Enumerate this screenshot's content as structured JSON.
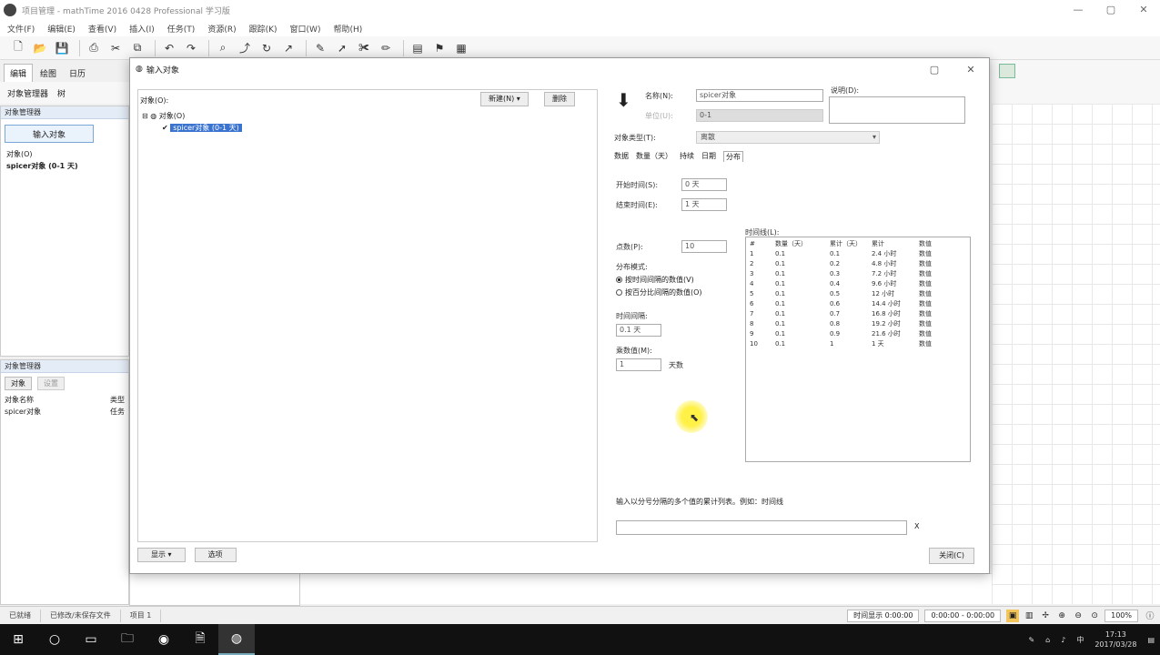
{
  "app": {
    "title": "项目管理 - mathTime 2016 0428 Professional 学习版",
    "window_controls": [
      "—",
      "▢",
      "✕"
    ]
  },
  "menu": [
    "文件(F)",
    "编辑(E)",
    "查看(V)",
    "插入(I)",
    "任务(T)",
    "资源(R)",
    "跟踪(K)",
    "窗口(W)",
    "帮助(H)"
  ],
  "main_tabs": [
    "编辑",
    "绘图",
    "日历"
  ],
  "sub_toolbar": [
    "对象管理器",
    "树"
  ],
  "left_panel": {
    "header": "对象管理器",
    "input_button": "输入对象",
    "tree": [
      "对象(O)",
      "spicer对象 (0-1 天)"
    ]
  },
  "lower_panel": {
    "header": "对象管理器",
    "toolbar": [
      "对象",
      "设置"
    ],
    "rows": [
      {
        "name": "对象名称",
        "value": "类型"
      },
      {
        "name": "spicer对象",
        "value": "任务"
      }
    ]
  },
  "statusbar": {
    "left": [
      "已就绪",
      "已修改/未保存文件",
      "项目 1"
    ],
    "right_fields": [
      "时间显示 0:00:00",
      "0:00:00 - 0:00:00"
    ],
    "zoom": "100%"
  },
  "taskbar": {
    "time": "17:13",
    "date": "2017/03/28"
  },
  "dialog": {
    "title": "输入对象",
    "left": {
      "label": "对象(O):",
      "btn_new": "新建(N) ▾",
      "btn_delete": "删除",
      "tree_root": "对象(O)",
      "tree_selected": "spicer对象 (0-1 天)"
    },
    "bottom_buttons": [
      "显示 ▾",
      "选项"
    ],
    "close_button": "关闭(C)",
    "right": {
      "name_label": "名称(N):",
      "name_value": "spicer对象",
      "unit_label": "单位(U):",
      "unit_value": "0-1",
      "notes_label": "说明(D):",
      "type_label": "对象类型(T):",
      "type_value": "离散",
      "subtabs": [
        "数据",
        "数量（天）",
        "持续",
        "日期",
        "分布"
      ],
      "start_label": "开始时间(S):",
      "start_value": "0 天",
      "end_label": "结束时间(E):",
      "end_value": "1 天",
      "count_label": "点数(P):",
      "count_value": "10",
      "timeline_label": "时间线(L):",
      "radio_title": "分布模式:",
      "radio_1": "按时间间隔的数值(V)",
      "radio_2": "按百分比间隔的数值(O)",
      "interval_label": "时间间隔:",
      "interval_value": "0.1 天",
      "multiplier_label": "乘数值(M):",
      "multiplier_value": "1",
      "multiplier_unit": "天数",
      "table_headers": [
        "#",
        "数量（天）",
        "累计（天）",
        "累计",
        "数值"
      ],
      "table_rows": [
        [
          "1",
          "0.1",
          "0.1",
          "2.4 小时",
          "数值"
        ],
        [
          "2",
          "0.1",
          "0.2",
          "4.8 小时",
          "数值"
        ],
        [
          "3",
          "0.1",
          "0.3",
          "7.2 小时",
          "数值"
        ],
        [
          "4",
          "0.1",
          "0.4",
          "9.6 小时",
          "数值"
        ],
        [
          "5",
          "0.1",
          "0.5",
          "12 小时",
          "数值"
        ],
        [
          "6",
          "0.1",
          "0.6",
          "14.4 小时",
          "数值"
        ],
        [
          "7",
          "0.1",
          "0.7",
          "16.8 小时",
          "数值"
        ],
        [
          "8",
          "0.1",
          "0.8",
          "19.2 小时",
          "数值"
        ],
        [
          "9",
          "0.1",
          "0.9",
          "21.6 小时",
          "数值"
        ],
        [
          "10",
          "0.1",
          "1",
          "1 天",
          "数值"
        ]
      ],
      "bottom_hint": "输入以分号分隔的多个值的累计列表。例如：时间线",
      "bottom_x": "X"
    }
  }
}
